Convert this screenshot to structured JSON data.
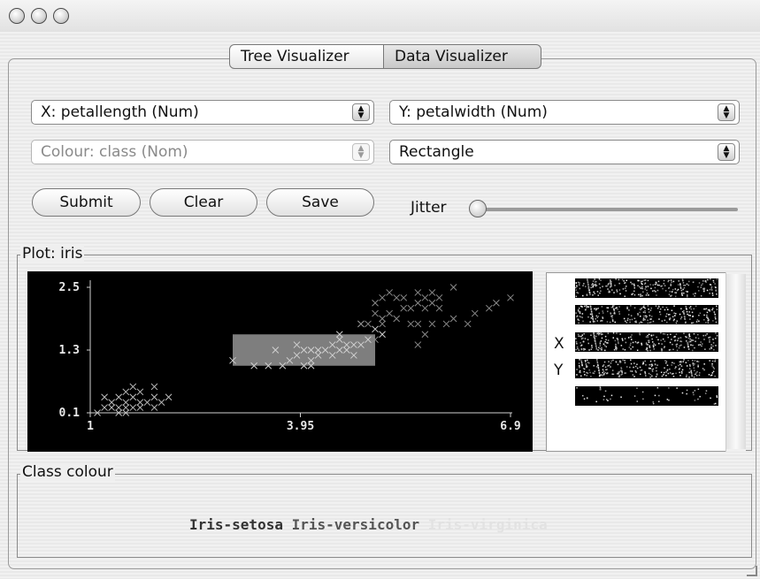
{
  "window": {
    "title": ""
  },
  "tabs": [
    {
      "label": "Tree Visualizer",
      "active": false
    },
    {
      "label": "Data Visualizer",
      "active": true
    }
  ],
  "controls": {
    "x_axis": "X: petallength (Num)",
    "y_axis": "Y: petalwidth (Num)",
    "colour": "Colour: class (Nom)",
    "shape": "Rectangle",
    "buttons": {
      "submit": "Submit",
      "clear": "Clear",
      "save": "Save"
    },
    "jitter_label": "Jitter",
    "jitter_value": 0
  },
  "plot": {
    "title": "Plot: iris",
    "y_ticks": [
      "2.5",
      "1.3",
      "0.1"
    ],
    "x_ticks": [
      "1",
      "3.95",
      "6.9"
    ],
    "side_labels": {
      "x": "X",
      "y": "Y"
    },
    "selection_rectangle": {
      "x_range": [
        3.0,
        5.0
      ],
      "y_range": [
        1.0,
        1.6
      ]
    }
  },
  "chart_data": {
    "type": "scatter",
    "title": "",
    "xlabel": "petallength",
    "ylabel": "petalwidth",
    "xlim": [
      1,
      6.9
    ],
    "ylim": [
      0.1,
      2.5
    ],
    "series": [
      {
        "name": "Iris-setosa",
        "color": "#bdbdbd",
        "points": [
          [
            1.2,
            0.2
          ],
          [
            1.3,
            0.3
          ],
          [
            1.4,
            0.2
          ],
          [
            1.4,
            0.4
          ],
          [
            1.5,
            0.2
          ],
          [
            1.5,
            0.3
          ],
          [
            1.6,
            0.2
          ],
          [
            1.6,
            0.4
          ],
          [
            1.7,
            0.3
          ],
          [
            1.7,
            0.5
          ],
          [
            1.8,
            0.3
          ],
          [
            1.9,
            0.4
          ],
          [
            1.9,
            0.2
          ],
          [
            1.5,
            0.5
          ],
          [
            1.3,
            0.2
          ],
          [
            1.1,
            0.1
          ],
          [
            1.4,
            0.1
          ],
          [
            1.6,
            0.6
          ],
          [
            1.7,
            0.2
          ],
          [
            2.0,
            0.3
          ],
          [
            2.1,
            0.4
          ],
          [
            1.9,
            0.6
          ],
          [
            1.2,
            0.4
          ],
          [
            1.5,
            0.1
          ]
        ]
      },
      {
        "name": "Iris-versicolor",
        "color": "#d0d0d0",
        "points": [
          [
            3.0,
            1.1
          ],
          [
            3.3,
            1.0
          ],
          [
            3.5,
            1.0
          ],
          [
            3.6,
            1.3
          ],
          [
            3.7,
            1.0
          ],
          [
            3.8,
            1.1
          ],
          [
            3.9,
            1.2
          ],
          [
            3.9,
            1.4
          ],
          [
            4.0,
            1.3
          ],
          [
            4.0,
            1.0
          ],
          [
            4.1,
            1.3
          ],
          [
            4.1,
            1.0
          ],
          [
            4.2,
            1.2
          ],
          [
            4.2,
            1.3
          ],
          [
            4.3,
            1.3
          ],
          [
            4.4,
            1.4
          ],
          [
            4.4,
            1.2
          ],
          [
            4.5,
            1.5
          ],
          [
            4.5,
            1.3
          ],
          [
            4.6,
            1.4
          ],
          [
            4.6,
            1.3
          ],
          [
            4.7,
            1.4
          ],
          [
            4.7,
            1.2
          ],
          [
            4.8,
            1.8
          ],
          [
            4.8,
            1.4
          ],
          [
            4.9,
            1.5
          ],
          [
            5.0,
            1.7
          ],
          [
            5.1,
            1.6
          ],
          [
            4.5,
            1.6
          ],
          [
            4.1,
            1.1
          ]
        ]
      },
      {
        "name": "Iris-virginica",
        "color": "#8a8a8a",
        "points": [
          [
            4.8,
            1.8
          ],
          [
            4.9,
            1.8
          ],
          [
            5.0,
            1.5
          ],
          [
            5.0,
            2.0
          ],
          [
            5.1,
            1.9
          ],
          [
            5.1,
            2.3
          ],
          [
            5.2,
            2.0
          ],
          [
            5.3,
            2.3
          ],
          [
            5.4,
            2.1
          ],
          [
            5.5,
            1.8
          ],
          [
            5.5,
            2.1
          ],
          [
            5.6,
            1.4
          ],
          [
            5.6,
            2.4
          ],
          [
            5.7,
            2.3
          ],
          [
            5.8,
            1.8
          ],
          [
            5.8,
            2.2
          ],
          [
            5.9,
            2.3
          ],
          [
            6.0,
            1.8
          ],
          [
            6.1,
            2.5
          ],
          [
            6.1,
            1.9
          ],
          [
            5.6,
            2.2
          ],
          [
            5.7,
            2.1
          ],
          [
            5.3,
            1.9
          ],
          [
            5.1,
            1.8
          ],
          [
            5.7,
            1.6
          ],
          [
            5.9,
            2.1
          ],
          [
            6.4,
            2.0
          ],
          [
            6.7,
            2.2
          ],
          [
            6.9,
            2.3
          ],
          [
            5.4,
            2.3
          ],
          [
            5.6,
            1.8
          ],
          [
            5.8,
            2.4
          ],
          [
            6.3,
            1.8
          ],
          [
            6.6,
            2.1
          ],
          [
            5.0,
            2.2
          ],
          [
            5.2,
            2.4
          ]
        ]
      }
    ]
  },
  "class_colour": {
    "title": "Class colour",
    "classes": [
      {
        "name": "Iris-setosa",
        "color": "#333333"
      },
      {
        "name": "Iris-versicolor",
        "color": "#555555"
      },
      {
        "name": "Iris-virginica",
        "color": "#e2e2e2"
      }
    ]
  }
}
